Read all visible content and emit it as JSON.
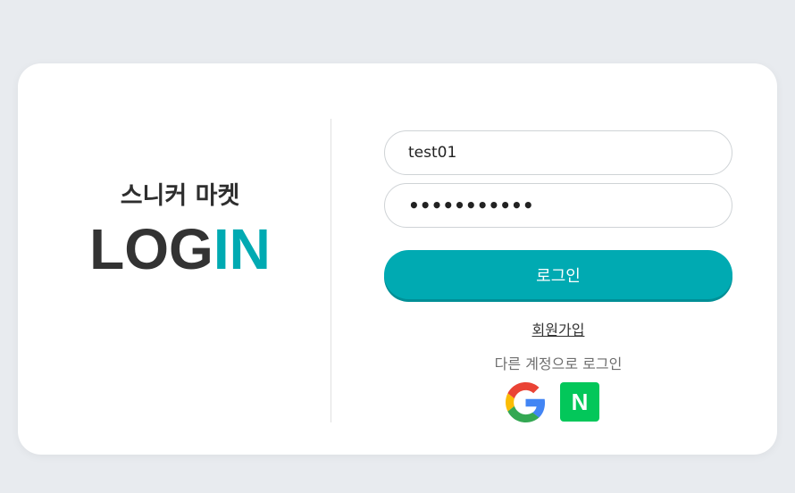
{
  "left_panel": {
    "subtitle": "스니커 마켓",
    "title_part1": "LOG",
    "title_part2": "IN"
  },
  "form": {
    "id_value": "test01",
    "password_value": "•••••••••••",
    "login_label": "로그인",
    "signup_label": "회원가입",
    "other_login_text": "다른 계정으로 로그인"
  },
  "social": {
    "naver_letter": "N"
  },
  "colors": {
    "accent": "#00aab2",
    "naver": "#03c75a",
    "background": "#e8ebef"
  }
}
